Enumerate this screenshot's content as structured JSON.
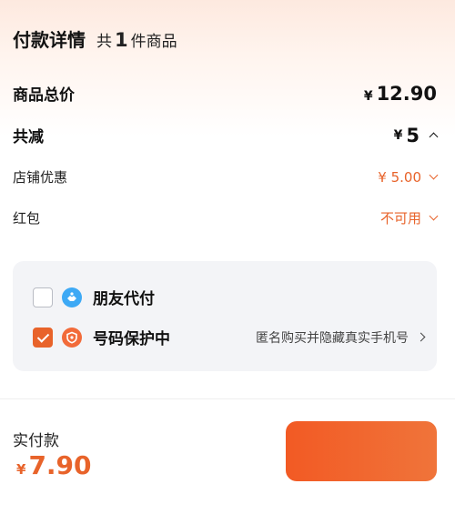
{
  "header": {
    "title": "付款详情",
    "count_prefix": "共",
    "count_num": "1",
    "count_suffix": "件商品"
  },
  "summary": {
    "total_label": "商品总价",
    "total_currency": "¥",
    "total_value": "12.90",
    "discount_label": "共减",
    "discount_currency": "¥",
    "discount_value": "5",
    "shop_discount_label": "店铺优惠",
    "shop_discount_value": "¥ 5.00",
    "redpacket_label": "红包",
    "redpacket_value": "不可用"
  },
  "options": {
    "friend_pay_label": "朋友代付",
    "friend_pay_checked": false,
    "privacy_label": "号码保护中",
    "privacy_checked": true,
    "privacy_desc": "匿名购买并隐藏真实手机号"
  },
  "footer": {
    "pay_label": "实付款",
    "pay_currency": "¥",
    "pay_value": "7.90",
    "submit_label": ""
  },
  "colors": {
    "accent": "#e8632a",
    "card_bg": "#f3f4f7",
    "friend_icon": "#3da9f5",
    "privacy_icon": "#f26b3a"
  },
  "icons": {
    "friend_pay": "handshake-icon",
    "privacy": "shield-icon"
  }
}
